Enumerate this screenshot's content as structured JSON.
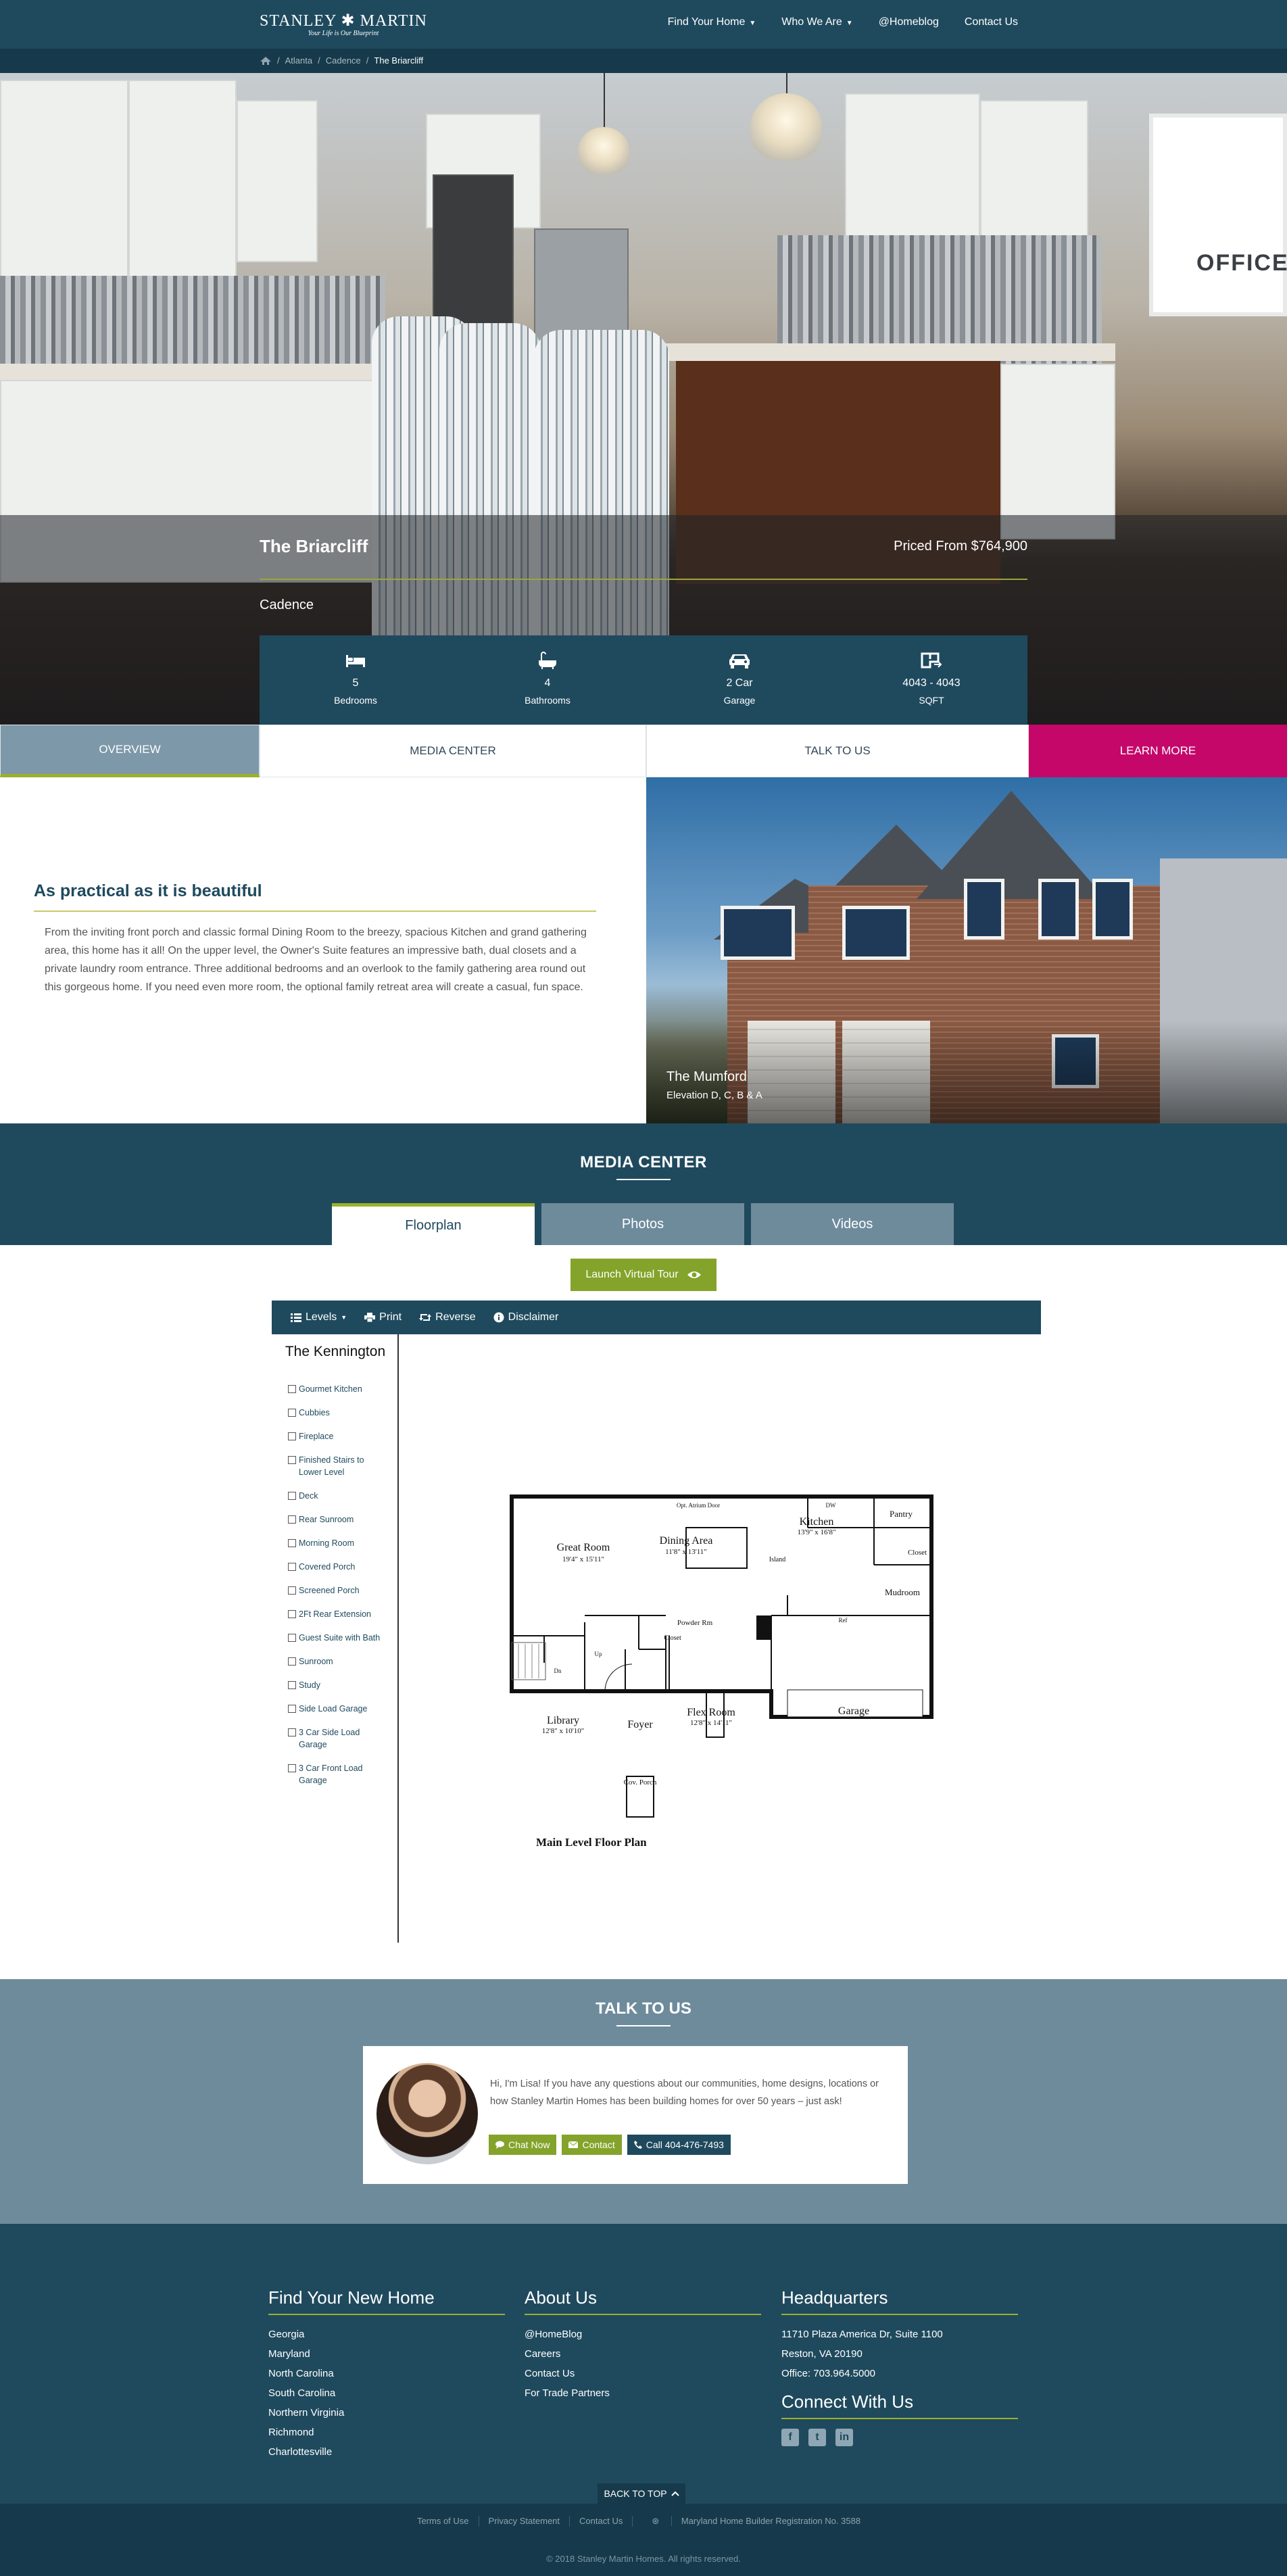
{
  "nav": {
    "logo_line1": "STANLEY ✱ MARTIN",
    "logo_line2": "Your Life is Our Blueprint",
    "links": [
      "Find Your Home",
      "Who We Are",
      "@Homeblog",
      "Contact Us"
    ]
  },
  "breadcrumb": {
    "items": [
      "Atlanta",
      "Cadence"
    ],
    "current": "The Briarcliff"
  },
  "hero": {
    "title": "The Briarcliff",
    "price": "Priced From $764,900",
    "community": "Cadence",
    "window_text": "OFFICE",
    "stats": [
      {
        "icon": "bed-icon",
        "value": "5",
        "label": "Bedrooms"
      },
      {
        "icon": "bathtub-icon",
        "value": "4",
        "label": "Bathrooms"
      },
      {
        "icon": "car-icon",
        "value": "2 Car",
        "label": "Garage"
      },
      {
        "icon": "floorplan-icon",
        "value": "4043 - 4043",
        "label": "SQFT"
      }
    ]
  },
  "tabs": [
    "Overview",
    "Media Center",
    "Talk To Us",
    "Learn More"
  ],
  "overview": {
    "title": "As practical as it is beautiful",
    "text": "From the inviting front porch and classic formal Dining Room to the breezy, spacious Kitchen and grand gathering area, this home has it all! On the upper level, the Owner's Suite features an impressive bath, dual closets and a private laundry room entrance. Three additional bedrooms and an overlook to the family gathering area round out this gorgeous home. If you need even more room, the optional family retreat area will create a casual, fun space.",
    "photo_caption": "The Mumford",
    "photo_subcaption": "Elevation D, C, B & A"
  },
  "media": {
    "title": "Media Center",
    "tabs": [
      "Floorplan",
      "Photos",
      "Videos"
    ],
    "tour_button": "Launch Virtual Tour",
    "toolbar": [
      "Levels",
      "Print",
      "Reverse",
      "Disclaimer"
    ],
    "plan_name": "The Kennington",
    "options": [
      "Gourmet Kitchen",
      "Cubbies",
      "Fireplace",
      "Finished Stairs to Lower Level",
      "Deck",
      "Rear Sunroom",
      "Morning Room",
      "Covered Porch",
      "Screened Porch",
      "2Ft Rear Extension",
      "Guest Suite with Bath",
      "Sunroom",
      "Study",
      "Side Load Garage",
      "3 Car Side Load Garage",
      "3 Car Front Load Garage"
    ],
    "rooms": {
      "great_room": "Great Room",
      "great_room_size": "19'4\" x 15'11\"",
      "dining": "Dining Area",
      "dining_size": "11'8\" x 13'11\"",
      "kitchen": "Kitchen",
      "kitchen_size": "13'9\" x 16'8\"",
      "pantry": "Pantry",
      "closet": "Closet",
      "mudroom": "Mudroom",
      "island": "Island",
      "powder": "Powder Rm",
      "library": "Library",
      "library_size": "12'8\" x 10'10\"",
      "foyer": "Foyer",
      "flex": "Flex Room",
      "flex_size": "12'8\" x 14'11\"",
      "garage": "Garage",
      "porch": "Cov. Porch",
      "opt_atrium": "Opt. Atrium Door",
      "ref": "Ref",
      "dw": "DW",
      "up": "Up",
      "dn": "Dn"
    },
    "plan_caption": "Main Level Floor Plan"
  },
  "talk": {
    "title": "Talk To Us",
    "text": "Hi, I'm Lisa! If you have any questions about our communities, home designs, locations or how Stanley Martin Homes has been building homes for over 50 years – just ask!",
    "buttons": [
      "Chat Now",
      "Contact",
      "Call 404-476-7493"
    ]
  },
  "footer": {
    "col1_title": "Find Your New Home",
    "col1_items": [
      "Georgia",
      "Maryland",
      "North Carolina",
      "South Carolina",
      "Northern Virginia",
      "Richmond",
      "Charlottesville"
    ],
    "col2_title": "About Us",
    "col2_items": [
      "@HomeBlog",
      "Careers",
      "Contact Us",
      "For Trade Partners"
    ],
    "col3_title": "Headquarters",
    "col3_items": [
      "11710 Plaza America Dr, Suite 1100",
      "Reston, VA 20190",
      "Office: 703.964.5000"
    ],
    "connect_title": "Connect With Us",
    "back_to_top": "BACK TO TOP",
    "sublinks": [
      "Terms of Use",
      "Privacy Statement",
      "Contact Us",
      "Maryland Home Builder Registration No. 3588"
    ],
    "copyright": "© 2018 Stanley Martin Homes. All rights reserved."
  },
  "colors": {
    "navy": "#1f4a5e",
    "slate": "#6e8b9c",
    "green": "#84a32a",
    "magenta": "#c5076a"
  }
}
